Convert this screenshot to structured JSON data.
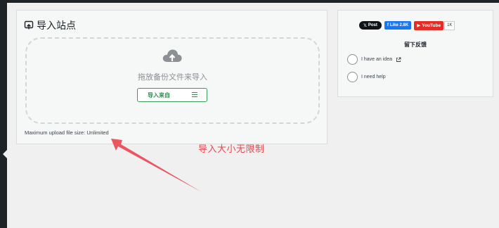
{
  "import_panel": {
    "title": "导入站点",
    "title_icon": "import-box-icon",
    "drop_text": "拖放备份文件来导入",
    "upload_icon": "cloud-upload-icon",
    "import_button_label": "导入来自",
    "menu_icon": "hamburger-menu-icon",
    "max_upload_text": "Maximum upload file size: Unlimited"
  },
  "annotation": {
    "text": "导入大小无限制",
    "color": "#e5484d"
  },
  "social": {
    "x_label": "Post",
    "fb_label": "Like 2.8K",
    "yt_label": "YouTube",
    "yt_count": "1K"
  },
  "feedback": {
    "title": "留下反馈",
    "items": [
      {
        "label": "I have an idea"
      },
      {
        "label": "I need help"
      }
    ]
  },
  "colors": {
    "accent_green": "#2e8b50",
    "admin_dark": "#1d2327",
    "facebook": "#1877f2",
    "youtube": "#e52d27"
  }
}
